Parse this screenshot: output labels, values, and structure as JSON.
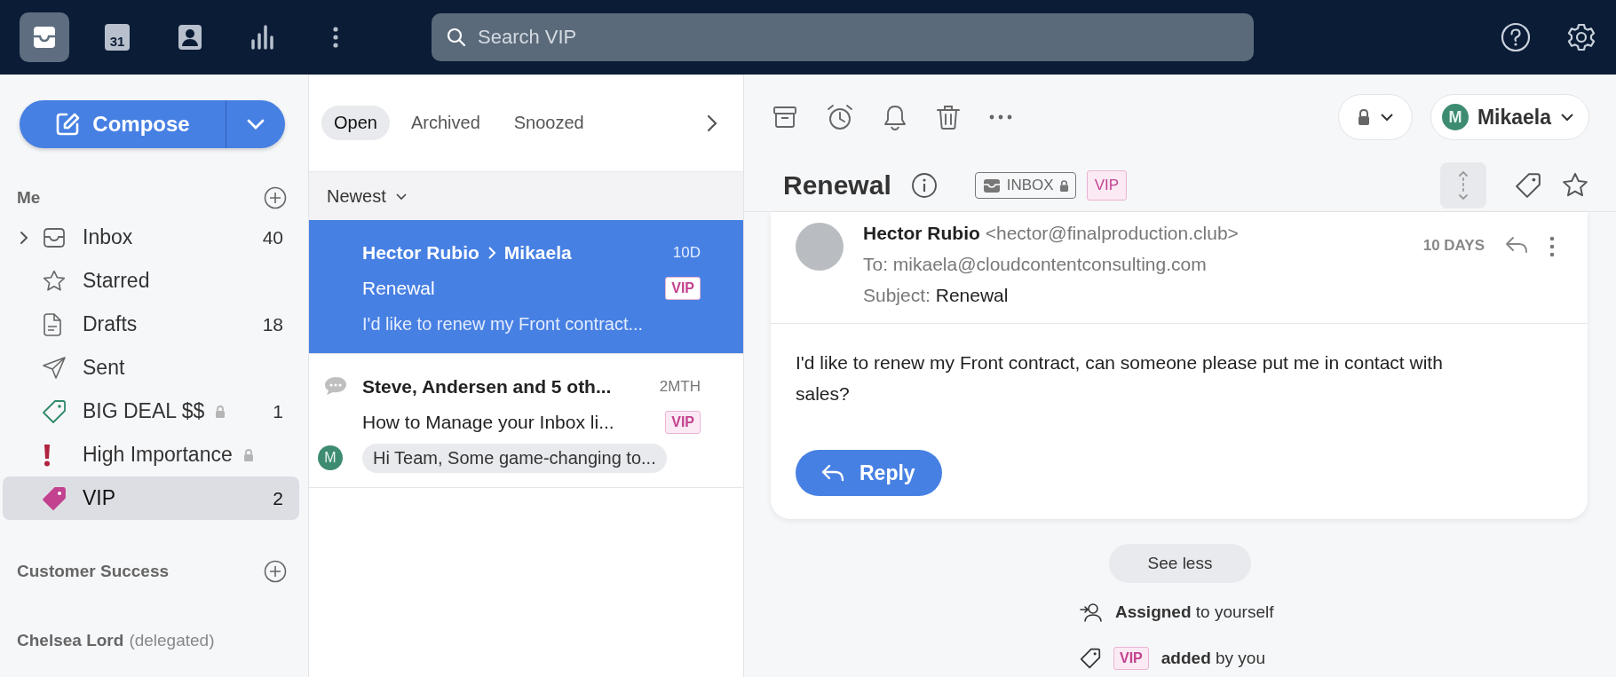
{
  "top_bar": {
    "nav": [
      {
        "kind": "inbox",
        "selected": true
      },
      {
        "kind": "calendar",
        "selected": false,
        "text": "31"
      },
      {
        "kind": "contacts",
        "selected": false
      },
      {
        "kind": "analytics",
        "selected": false
      },
      {
        "kind": "more",
        "selected": false
      }
    ],
    "search": {
      "placeholder": "Search VIP"
    }
  },
  "sidebar": {
    "compose": "Compose",
    "sections": [
      {
        "title": "Me",
        "add": true,
        "items": [
          {
            "label": "Inbox",
            "kind": "inbox",
            "count": "40",
            "expanded": false,
            "selected": false
          },
          {
            "label": "Starred",
            "kind": "star",
            "selected": false
          },
          {
            "label": "Drafts",
            "kind": "draft",
            "count": "18",
            "selected": false
          },
          {
            "label": "Sent",
            "kind": "sent",
            "selected": false
          },
          {
            "label": "BIG DEAL $$",
            "kind": "tag",
            "color": "#2f8a6a",
            "locked": true,
            "count": "1",
            "selected": false
          },
          {
            "label": "High Importance",
            "kind": "important",
            "color": "#b0243f",
            "locked": true,
            "selected": false
          },
          {
            "label": "VIP",
            "kind": "tagfilled",
            "color": "#c2428f",
            "count": "2",
            "selected": true
          }
        ]
      },
      {
        "title": "Customer Success",
        "add": true
      },
      {
        "title": "Chelsea Lord",
        "note": "(delegated)"
      }
    ]
  },
  "list": {
    "tabs": [
      {
        "label": "Open",
        "selected": true
      },
      {
        "label": "Archived",
        "selected": false
      },
      {
        "label": "Snoozed",
        "selected": false
      }
    ],
    "sort": "Newest",
    "conversations": [
      {
        "kind": "email",
        "selected": true,
        "from": "Hector Rubio",
        "to": "Mikaela",
        "time": "10D",
        "subject": "Renewal",
        "tag": "VIP",
        "preview": "I'd like to renew my Front contract..."
      },
      {
        "kind": "comment",
        "selected": false,
        "from": "Steve, Andersen and 5 oth...",
        "time": "2MTH",
        "subject": "How to Manage your Inbox li...",
        "tag": "VIP",
        "avatar": "M",
        "preview": "Hi Team, Some game-changing to..."
      }
    ]
  },
  "conversation": {
    "assignee": {
      "initial": "M",
      "name": "Mikaela"
    },
    "title": "Renewal",
    "inbox_tag": {
      "label": "INBOX",
      "locked": true
    },
    "tag": "VIP",
    "message": {
      "from_name": "Hector Rubio",
      "from_email": "<hector@finalproduction.club>",
      "to": "To: mikaela@cloudcontentconsulting.com",
      "subject_label": "Subject:",
      "subject": "Renewal",
      "time": "10 DAYS",
      "body": "I'd like to renew my Front contract, can someone please put me in contact with sales?",
      "reply": "Reply"
    },
    "see_less": "See less",
    "activity": [
      {
        "kind": "assign",
        "text": "**Assigned** to yourself"
      },
      {
        "kind": "tag",
        "tag": "VIP",
        "text": "**added** by you"
      }
    ]
  }
}
